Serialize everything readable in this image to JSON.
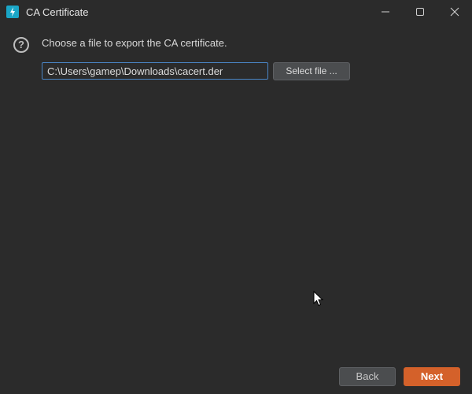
{
  "window": {
    "title": "CA Certificate",
    "app_icon": "bolt-icon",
    "controls": [
      "minimize-icon",
      "maximize-icon",
      "close-icon"
    ]
  },
  "content": {
    "help_icon": "question-circle-icon",
    "help_glyph": "?",
    "instruction": "Choose a file to export the CA certificate.",
    "file_path_value": "C:\\Users\\gamep\\Downloads\\cacert.der",
    "select_file_label": "Select file ..."
  },
  "footer": {
    "back_label": "Back",
    "next_label": "Next"
  },
  "colors": {
    "background": "#2b2b2b",
    "accent": "#d4612a",
    "app_icon": "#1aa6c7",
    "input_focus_border": "#4a86c7"
  }
}
